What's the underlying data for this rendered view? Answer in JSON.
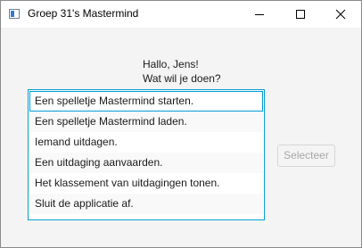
{
  "window": {
    "title": "Groep 31's Mastermind",
    "minimize_icon": "minimize-icon",
    "maximize_icon": "maximize-icon",
    "close_icon": "close-icon"
  },
  "greeting": {
    "line1": "Hallo, Jens!",
    "line2": "Wat wil je doen?"
  },
  "menu": {
    "items": [
      "Een spelletje Mastermind starten.",
      "Een spelletje Mastermind laden.",
      "Iemand uitdagen.",
      "Een uitdaging aanvaarden.",
      "Het klassement van uitdagingen tonen.",
      "Sluit de applicatie af."
    ],
    "focused_index": 0
  },
  "select_button": {
    "label": "Selecteer",
    "enabled": false
  },
  "colors": {
    "focus": "#039ed3",
    "background": "#f4f4f4",
    "disabled_text": "#a7a7a7"
  }
}
